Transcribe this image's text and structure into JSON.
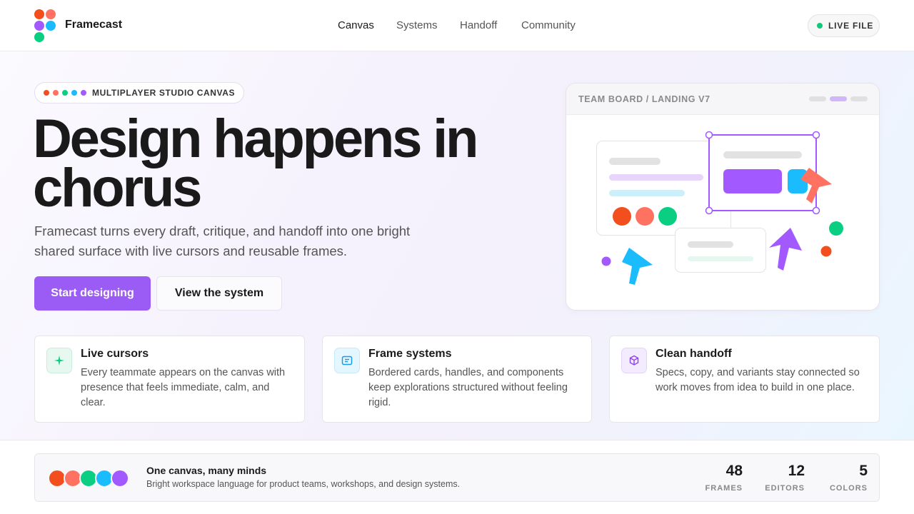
{
  "header": {
    "brand": "Framecast",
    "nav": [
      "Canvas",
      "Systems",
      "Handoff",
      "Community"
    ],
    "status_label": "LIVE FILE"
  },
  "hero": {
    "eyebrow": "MULTIPLAYER STUDIO CANVAS",
    "headline_line1": "Design happens in",
    "headline_line2": "chorus",
    "subhead": "Framecast turns every draft, critique, and handoff into one bright shared surface with live cursors and reusable frames.",
    "primary_cta": "Start designing",
    "secondary_cta": "View the system"
  },
  "board": {
    "title": "TEAM BOARD / LANDING V7"
  },
  "features": [
    {
      "title": "Live cursors",
      "body": "Every teammate appears on the canvas with presence that feels immediate, calm, and clear.",
      "icon": "sparkle-icon"
    },
    {
      "title": "Frame systems",
      "body": "Bordered cards, handles, and components keep explorations structured without feeling rigid.",
      "icon": "frame-icon"
    },
    {
      "title": "Clean handoff",
      "body": "Specs, copy, and variants stay connected so work moves from idea to build in one place.",
      "icon": "package-icon"
    }
  ],
  "footer_bar": {
    "title": "One canvas, many minds",
    "subtitle": "Bright workspace language for product teams, workshops, and design systems.",
    "stats": [
      {
        "value": "48",
        "label": "FRAMES"
      },
      {
        "value": "12",
        "label": "EDITORS"
      },
      {
        "value": "5",
        "label": "COLORS"
      }
    ]
  },
  "colors": {
    "red": "#f24e1e",
    "coral": "#ff7262",
    "purple": "#a259ff",
    "blue": "#1abcfe",
    "green": "#0acf83",
    "accent": "#9b5cf6"
  }
}
